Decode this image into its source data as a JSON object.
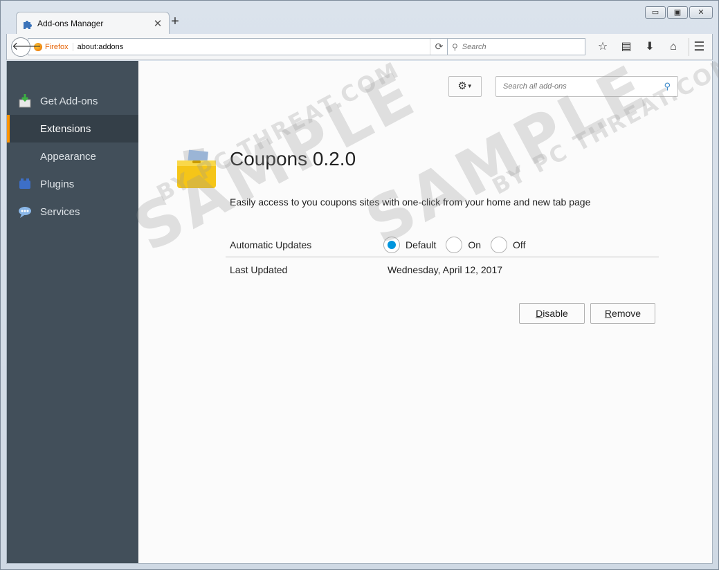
{
  "tab": {
    "title": "Add-ons Manager"
  },
  "window": {
    "minimize": "▭",
    "maximize": "▣",
    "close": "✕"
  },
  "navbar": {
    "identity_label": "Firefox",
    "url": "about:addons",
    "search_placeholder": "Search"
  },
  "toolbar": {
    "search_addons_placeholder": "Search all add-ons"
  },
  "sidebar": {
    "items": [
      {
        "label": "Get Add-ons",
        "icon": "get-addons-icon"
      },
      {
        "label": "Extensions",
        "icon": "extensions-icon",
        "selected": true
      },
      {
        "label": "Appearance",
        "icon": "appearance-icon"
      },
      {
        "label": "Plugins",
        "icon": "plugins-icon"
      },
      {
        "label": "Services",
        "icon": "services-icon"
      }
    ]
  },
  "addon": {
    "title": "Coupons 0.2.0",
    "description": "Easily access to you coupons sites with one-click from your home and new tab page",
    "auto_updates_label": "Automatic Updates",
    "auto_updates_options": [
      "Default",
      "On",
      "Off"
    ],
    "auto_updates_selected": "Default",
    "last_updated_label": "Last Updated",
    "last_updated_value": "Wednesday, April 12, 2017",
    "disable_first": "D",
    "disable_rest": "isable",
    "remove_first": "R",
    "remove_rest": "emove"
  },
  "watermark": {
    "main": "SAMPLE",
    "sub": "BY PC THREAT.COM"
  },
  "colors": {
    "accent": "#ff9500",
    "sidebar": "#424f5a",
    "radio": "#0095dd"
  }
}
